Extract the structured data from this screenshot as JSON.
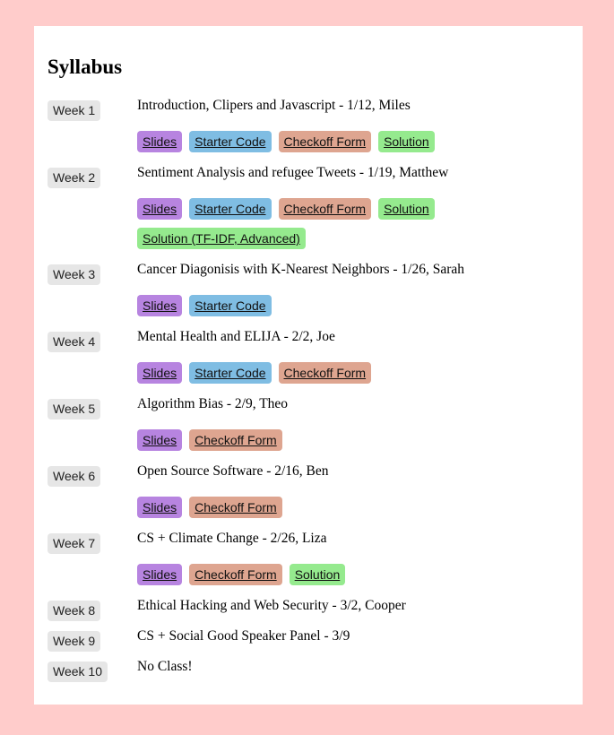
{
  "page": {
    "title": "Syllabus",
    "colors": {
      "background": "#ffcccb",
      "card": "#ffffff",
      "badge": "#e6e6e6",
      "slides": "#b784e0",
      "starter": "#7fbde3",
      "checkoff": "#dea590",
      "solution": "#95ea8e"
    }
  },
  "weeks": [
    {
      "label": "Week 1",
      "topic": "Introduction, Clipers and Javascript - 1/12, Miles",
      "links": {
        "slides": "Slides",
        "starter": "Starter Code",
        "checkoff": "Checkoff Form",
        "solution": "Solution"
      }
    },
    {
      "label": "Week 2",
      "topic": "Sentiment Analysis and refugee Tweets - 1/19, Matthew",
      "links": {
        "slides": "Slides",
        "starter": "Starter Code",
        "checkoff": "Checkoff Form",
        "solution": "Solution",
        "solution_advanced": "Solution (TF-IDF, Advanced)"
      }
    },
    {
      "label": "Week 3",
      "topic": "Cancer Diagonisis with K-Nearest Neighbors - 1/26, Sarah",
      "links": {
        "slides": "Slides",
        "starter": "Starter Code"
      }
    },
    {
      "label": "Week 4",
      "topic": "Mental Health and ELIJA - 2/2, Joe",
      "links": {
        "slides": "Slides",
        "starter": "Starter Code",
        "checkoff": "Checkoff Form"
      }
    },
    {
      "label": "Week 5",
      "topic": "Algorithm Bias - 2/9, Theo",
      "links": {
        "slides": "Slides",
        "checkoff": "Checkoff Form"
      }
    },
    {
      "label": "Week 6",
      "topic": "Open Source Software - 2/16, Ben",
      "links": {
        "slides": "Slides",
        "checkoff": "Checkoff Form"
      }
    },
    {
      "label": "Week 7",
      "topic": "CS + Climate Change - 2/26, Liza",
      "links": {
        "slides": "Slides",
        "checkoff": "Checkoff Form",
        "solution": "Solution"
      }
    },
    {
      "label": "Week 8",
      "topic": "Ethical Hacking and Web Security - 3/2, Cooper"
    },
    {
      "label": "Week 9",
      "topic": "CS + Social Good Speaker Panel - 3/9"
    },
    {
      "label": "Week 10",
      "topic": "No Class!"
    }
  ]
}
